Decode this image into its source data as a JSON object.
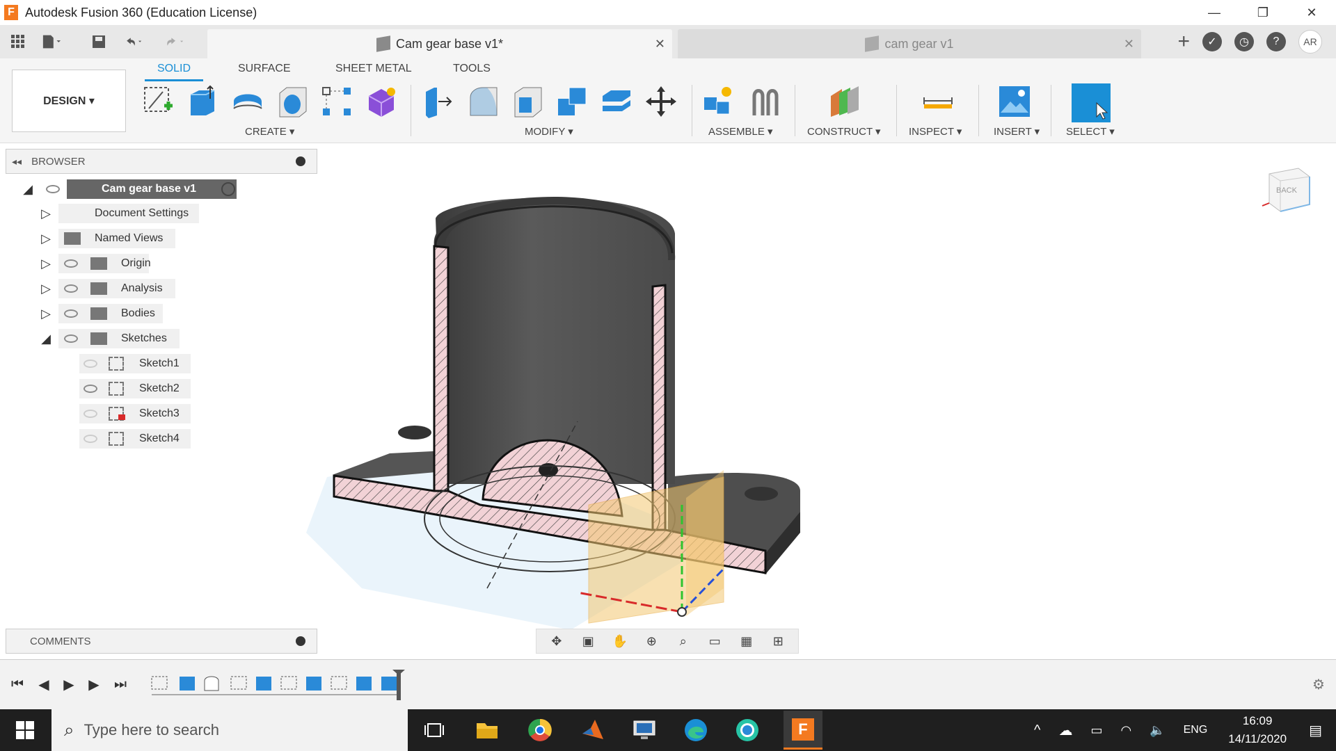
{
  "window": {
    "title": "Autodesk Fusion 360 (Education License)",
    "logo_letter": "F",
    "minimize": "—",
    "maximize": "❐",
    "close": "✕"
  },
  "tabs": [
    {
      "label": "Cam gear base v1*",
      "active": true
    },
    {
      "label": "cam gear v1",
      "active": false
    }
  ],
  "quick": {
    "tab_close": "✕",
    "new_tab": "+",
    "user_initials": "AR"
  },
  "ribbon": {
    "tabs": [
      "SOLID",
      "SURFACE",
      "SHEET METAL",
      "TOOLS"
    ],
    "workspace": "DESIGN ▾",
    "groups": {
      "create": "CREATE ▾",
      "modify": "MODIFY ▾",
      "assemble": "ASSEMBLE ▾",
      "construct": "CONSTRUCT ▾",
      "inspect": "INSPECT ▾",
      "insert": "INSERT ▾",
      "select": "SELECT ▾"
    }
  },
  "browser": {
    "title": "BROWSER",
    "root": "Cam gear base v1",
    "items": [
      "Document Settings",
      "Named Views",
      "Origin",
      "Analysis",
      "Bodies",
      "Sketches"
    ],
    "sketches": [
      "Sketch1",
      "Sketch2",
      "Sketch3",
      "Sketch4"
    ]
  },
  "viewcube": {
    "face": "BACK"
  },
  "comments": {
    "title": "COMMENTS"
  },
  "taskbar": {
    "search_placeholder": "Type here to search",
    "language": "ENG",
    "time": "16:09",
    "date": "14/11/2020"
  },
  "colors": {
    "accent": "#1a8fd6",
    "section_fill": "#f2d2d6",
    "body": "#4a4a4a",
    "plane": "#f3c872"
  }
}
